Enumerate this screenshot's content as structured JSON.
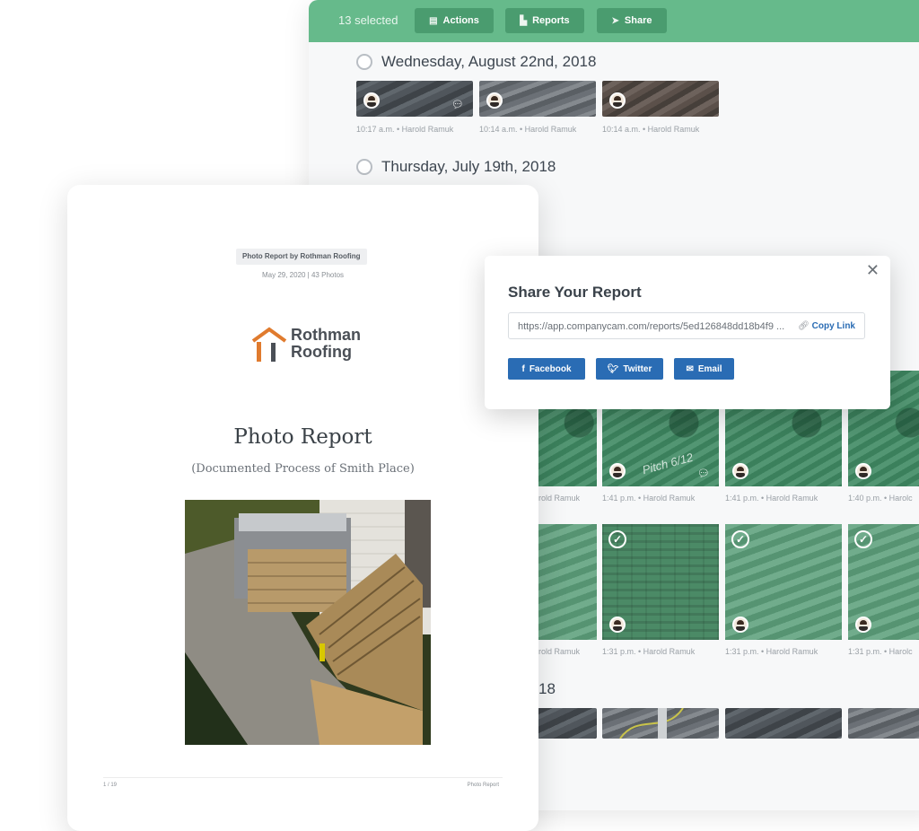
{
  "app": {
    "toolbar": {
      "selected": "13 selected",
      "actions": "Actions",
      "reports": "Reports",
      "share": "Share"
    },
    "groups": [
      {
        "date": "Wednesday, August 22nd, 2018",
        "captions": [
          "10:17 a.m. • Harold Ramuk",
          "10:14 a.m. • Harold Ramuk",
          "10:14 a.m. • Harold Ramuk"
        ]
      },
      {
        "date": "Thursday, July 19th, 2018"
      }
    ],
    "grid_row1_captions": [
      "rold Ramuk",
      "1:41 p.m. • Harold Ramuk",
      "1:41 p.m. • Harold Ramuk",
      "1:40 p.m. • Harolc"
    ],
    "grid_row2_captions": [
      "rold Ramuk",
      "1:31 p.m. • Harold Ramuk",
      "1:31 p.m. • Harold Ramuk",
      "1:31 p.m. • Harolc"
    ],
    "pitch_text": "Pitch 6/12",
    "year_fragment": "18"
  },
  "report": {
    "tag": "Photo Report by Rothman Roofing",
    "meta": "May 29, 2020 | 43 Photos",
    "logo_line1": "Rothman",
    "logo_line2": "Roofing",
    "title": "Photo Report",
    "subtitle": "(Documented Process of Smith Place)",
    "page_number": "1 / 19",
    "footer_title": "Photo Report"
  },
  "share": {
    "title": "Share Your Report",
    "url": "https://app.companycam.com/reports/5ed126848dd18b4f9 ...",
    "copy_link": "Copy Link",
    "facebook": "Facebook",
    "twitter": "Twitter",
    "email": "Email"
  },
  "colors": {
    "toolbar_green": "#66ba8b",
    "button_green": "#4a9c6f",
    "share_blue": "#2a6cb4",
    "logo_orange": "#e07b2e"
  }
}
